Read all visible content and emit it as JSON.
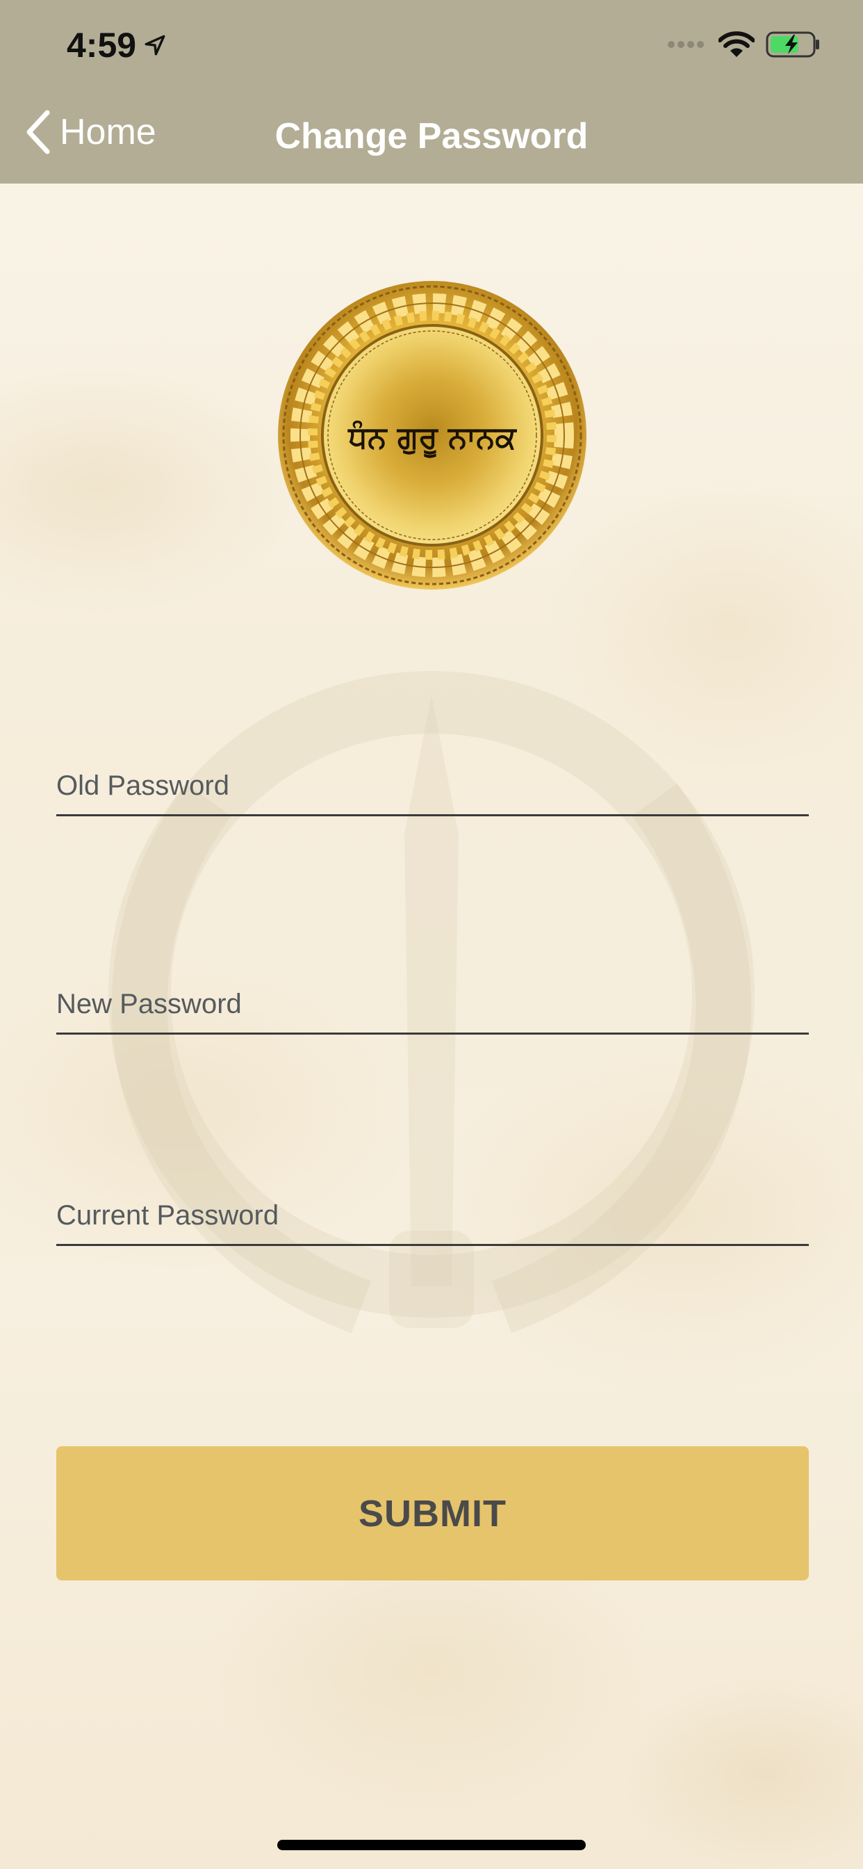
{
  "status_bar": {
    "time": "4:59",
    "location_icon": "location-arrow-icon",
    "signal_icon": "cellular-signal-icon",
    "wifi_icon": "wifi-icon",
    "battery_icon": "battery-charging-icon"
  },
  "nav": {
    "back_label": "Home",
    "back_icon": "chevron-left-icon",
    "title": "Change Password"
  },
  "logo": {
    "text": "ਧੰਨ ਗੁਰੂ ਨਾਨਕ"
  },
  "form": {
    "old_password_placeholder": "Old Password",
    "new_password_placeholder": "New Password",
    "current_password_placeholder": "Current Password",
    "submit_label": "SUBMIT"
  },
  "colors": {
    "header": "#b3ad95",
    "button": "#e6c46c",
    "button_text": "#4a4a4a",
    "battery_fill": "#4cd964"
  }
}
